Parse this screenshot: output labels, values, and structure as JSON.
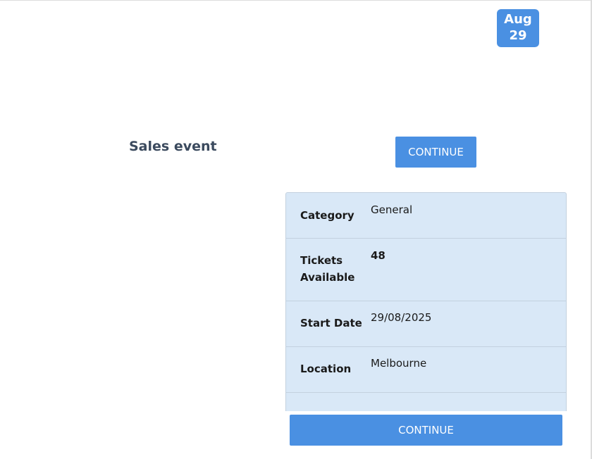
{
  "badge": {
    "month": "Aug",
    "day": "29"
  },
  "event": {
    "title": "Sales event"
  },
  "buttons": {
    "continue_top": "CONTINUE",
    "continue_bottom": "CONTINUE"
  },
  "details": {
    "category_label": "Category",
    "category_value": "General",
    "tickets_label_line1": "Tickets",
    "tickets_label_line2": "Available",
    "tickets_value": "48",
    "start_date_label": "Start Date",
    "start_date_value": "29/08/2025",
    "location_label": "Location",
    "location_value": "Melbourne"
  },
  "colors": {
    "accent": "#4a90e2",
    "panel": "#d9e8f7"
  }
}
